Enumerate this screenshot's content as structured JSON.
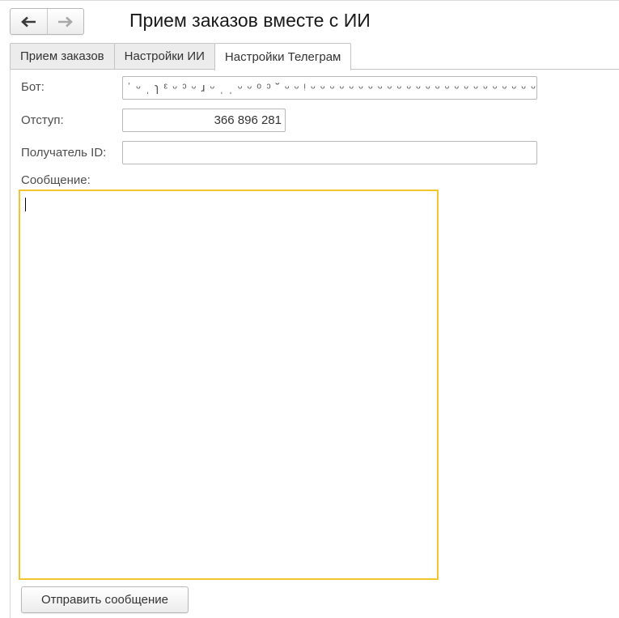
{
  "window": {
    "title": "Прием заказов вместе с ИИ"
  },
  "nav": {
    "back_icon": "arrow-left-icon",
    "forward_icon": "arrow-right-icon"
  },
  "tabs": [
    {
      "label": "Прием заказов",
      "active": false
    },
    {
      "label": "Настройки ИИ",
      "active": false
    },
    {
      "label": "Настройки Телеграм",
      "active": true
    }
  ],
  "form": {
    "bot": {
      "label": "Бот:",
      "value": "ˈ ᵕ ˌ ɿ ᵋ ᵕ ᵓ ᵕ ɹ ᵕ ˌ ˌ ᵕ ᵕ ᵒ ᵓ ˘ ᵕ ᵕ ᵎ ᵕ ᵕ ᵕ ᵕ ᵕ ᵕ ᵕ ᵕ ᵕ ᵕ ᵕ ᵕ ᵕ ᵕ ᵕ ᵕ ᵕ ᵕ ᵕ ᵕ ᵕ ᵕ ᵕ ᵕ ᵕ ᵕ ᵕ ᵕ ᵕ ᵕ ᵕ ᵕ ᵕ ᵕ ᵕ ᵕ ᵕ ᵕ ᵕ ᵕ ᵕ ᵕ ᵕ ᵕ ᵕ ᵕ ᵕ ᵕ ᵕ ᵕ ᵕ ᵕ ᵕ ᵕ ᵕ ᵕ ᵕ ᵕ"
    },
    "offset": {
      "label": "Отступ:",
      "value": "366 896 281"
    },
    "recipient": {
      "label": "Получатель ID:",
      "value": ""
    },
    "message": {
      "label": "Сообщение:",
      "value": ""
    }
  },
  "actions": {
    "send_label": "Отправить сообщение"
  },
  "colors": {
    "focus_border": "#f2c530",
    "tab_inactive": "#ececec",
    "border": "#b8b8b8"
  }
}
